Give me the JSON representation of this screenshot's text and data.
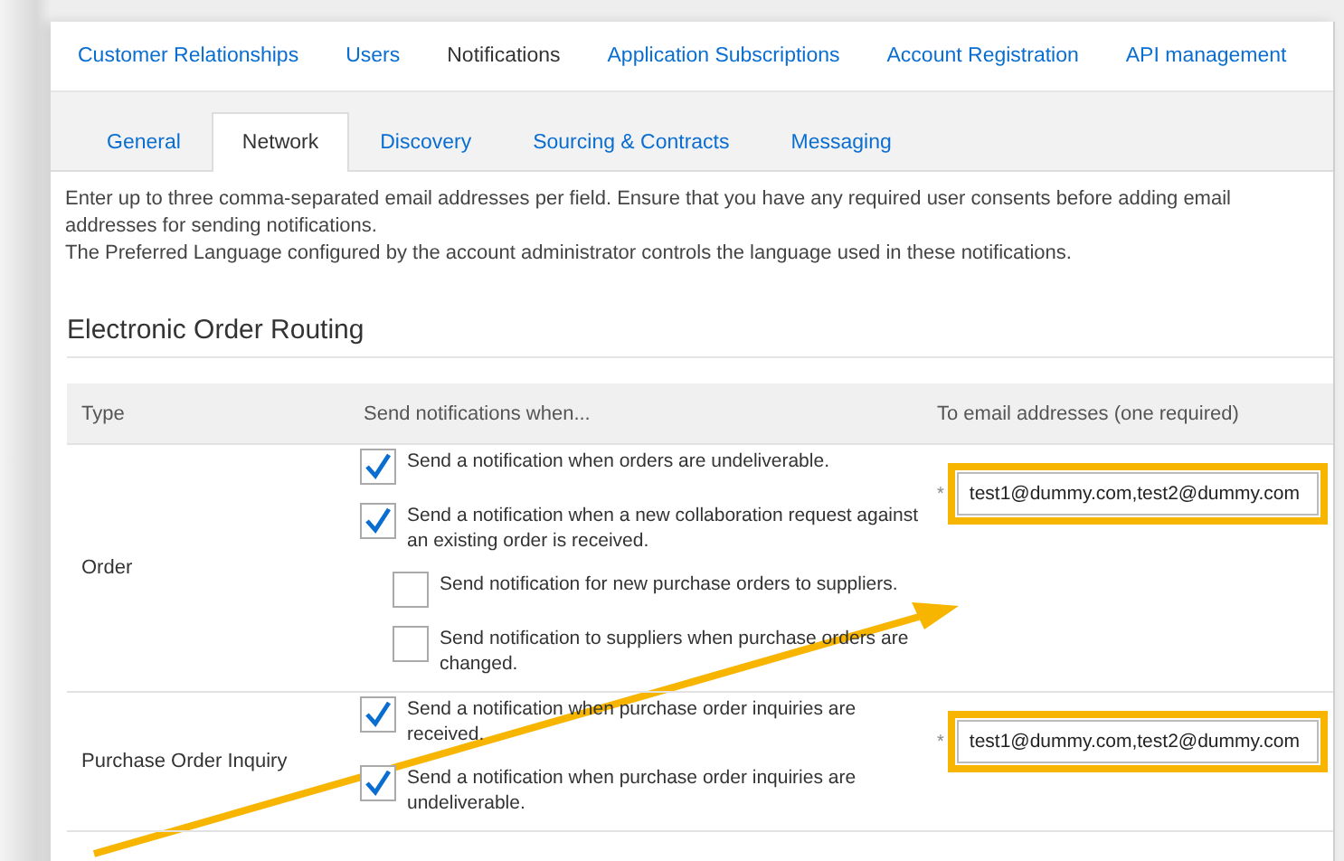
{
  "top_tabs": [
    {
      "label": "Customer Relationships",
      "selected": false
    },
    {
      "label": "Users",
      "selected": false
    },
    {
      "label": "Notifications",
      "selected": true
    },
    {
      "label": "Application Subscriptions",
      "selected": false
    },
    {
      "label": "Account Registration",
      "selected": false
    },
    {
      "label": "API management",
      "selected": false
    }
  ],
  "sub_tabs": [
    {
      "label": "General",
      "selected": false
    },
    {
      "label": "Network",
      "selected": true
    },
    {
      "label": "Discovery",
      "selected": false
    },
    {
      "label": "Sourcing & Contracts",
      "selected": false
    },
    {
      "label": "Messaging",
      "selected": false
    }
  ],
  "description": [
    "Enter up to three comma-separated email addresses per field. Ensure that you have any required user consents before adding email addresses for sending notifications.",
    "The Preferred Language configured by the account administrator controls the language used in these notifications."
  ],
  "section_title": "Electronic Order Routing",
  "table": {
    "columns": [
      "Type",
      "Send notifications when...",
      "To email addresses (one required)"
    ],
    "rows": [
      {
        "type": "Order",
        "options": [
          {
            "label": "Send a notification when orders are undeliverable.",
            "checked": true
          },
          {
            "label": "Send a notification when a new collaboration request against an existing order is received.",
            "checked": true,
            "children": [
              {
                "label": "Send notification for new purchase orders to suppliers.",
                "checked": false
              },
              {
                "label": "Send notification to suppliers when purchase orders are changed.",
                "checked": false
              }
            ]
          }
        ],
        "required_mark": "*",
        "email": "test1@dummy.com,test2@dummy.com",
        "highlighted": true
      },
      {
        "type": "Purchase Order Inquiry",
        "options": [
          {
            "label": "Send a notification when purchase order inquiries are received.",
            "checked": true
          },
          {
            "label": "Send a notification when purchase order inquiries are undeliverable.",
            "checked": true
          }
        ],
        "required_mark": "*",
        "email": "test1@dummy.com,test2@dummy.com",
        "highlighted": true
      }
    ]
  }
}
